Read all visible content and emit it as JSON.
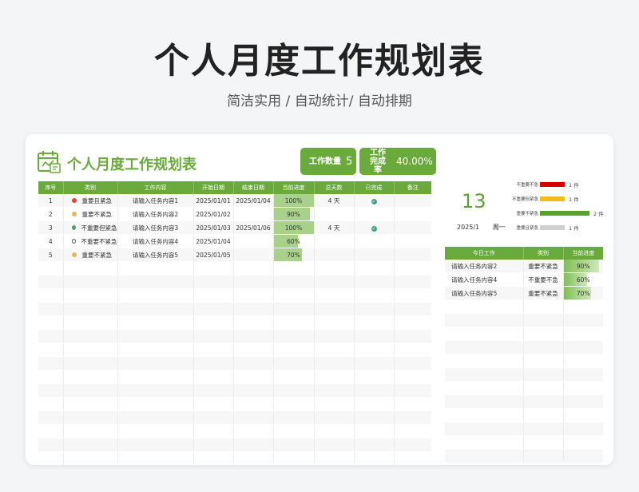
{
  "page": {
    "title": "个人月度工作规划表",
    "subtitle": "简洁实用 / 自动统计/ 自动排期"
  },
  "sheet": {
    "title": "个人月度工作规划表",
    "count_label": "工作数量",
    "count_value": "5",
    "rate_label_1": "工作",
    "rate_label_2": "完成率",
    "rate_value": "40.00%"
  },
  "colors": {
    "accent": "#6aaa3c",
    "important_urgent": "#d9433a",
    "important_not_urgent": "#e8b45c",
    "not_important_urgent": "#4e9c6c",
    "not_important_not_urgent": "#ffffff",
    "progress": "#a8d28b"
  },
  "table": {
    "headers": [
      "序号",
      "类别",
      "工作内容",
      "开始日期",
      "结束日期",
      "当前进度",
      "总天数",
      "已完成",
      "备注"
    ],
    "rows": [
      {
        "no": "1",
        "category": "重要且紧急",
        "dot": "#d9433a",
        "task": "请输入任务内容1",
        "start": "2025/01/01",
        "end": "2025/01/04",
        "progress": "100%",
        "progress_value": 1.0,
        "days": "4 天",
        "done": true,
        "note": ""
      },
      {
        "no": "2",
        "category": "重要不紧急",
        "dot": "#e8b45c",
        "task": "请输入任务内容2",
        "start": "2025/01/02",
        "end": "",
        "progress": "90%",
        "progress_value": 0.9,
        "days": "",
        "done": false,
        "note": ""
      },
      {
        "no": "3",
        "category": "不重要但紧急",
        "dot": "#4e9c6c",
        "task": "请输入任务内容3",
        "start": "2025/01/03",
        "end": "2025/01/06",
        "progress": "100%",
        "progress_value": 1.0,
        "days": "4 天",
        "done": true,
        "note": ""
      },
      {
        "no": "4",
        "category": "不重要不紧急",
        "dot": "#ffffff",
        "task": "请输入任务内容4",
        "start": "2025/01/04",
        "end": "",
        "progress": "60%",
        "progress_value": 0.6,
        "days": "",
        "done": false,
        "note": ""
      },
      {
        "no": "5",
        "category": "重要不紧急",
        "dot": "#e8b45c",
        "task": "请输入任务内容5",
        "start": "2025/01/05",
        "end": "",
        "progress": "70%",
        "progress_value": 0.7,
        "days": "",
        "done": false,
        "note": ""
      }
    ],
    "empty_rows": 16
  },
  "today": {
    "day": "13",
    "month": "2025/1",
    "weekday": "周一"
  },
  "category_chart": {
    "items": [
      {
        "label": "不重要不急",
        "value": 1,
        "value_label": "1 件",
        "color": "#d40000"
      },
      {
        "label": "不重要但紧急",
        "value": 1,
        "value_label": "1 件",
        "color": "#f2bc1c"
      },
      {
        "label": "重要不紧急",
        "value": 2,
        "value_label": "2 件",
        "color": "#5aa032"
      },
      {
        "label": "重要且紧急",
        "value": 1,
        "value_label": "1 件",
        "color": "#cfcfcf"
      }
    ],
    "max": 2
  },
  "today_table": {
    "headers": [
      "今日工作",
      "类别",
      "当前进度"
    ],
    "rows": [
      {
        "task": "请输入任务内容2",
        "category": "重要不紧急",
        "progress": "90%",
        "progress_value": 0.9
      },
      {
        "task": "请输入任务内容4",
        "category": "不重要不急",
        "progress": "60%",
        "progress_value": 0.6
      },
      {
        "task": "请输入任务内容5",
        "category": "重要不紧急",
        "progress": "70%",
        "progress_value": 0.7
      }
    ],
    "empty_rows": 12
  }
}
